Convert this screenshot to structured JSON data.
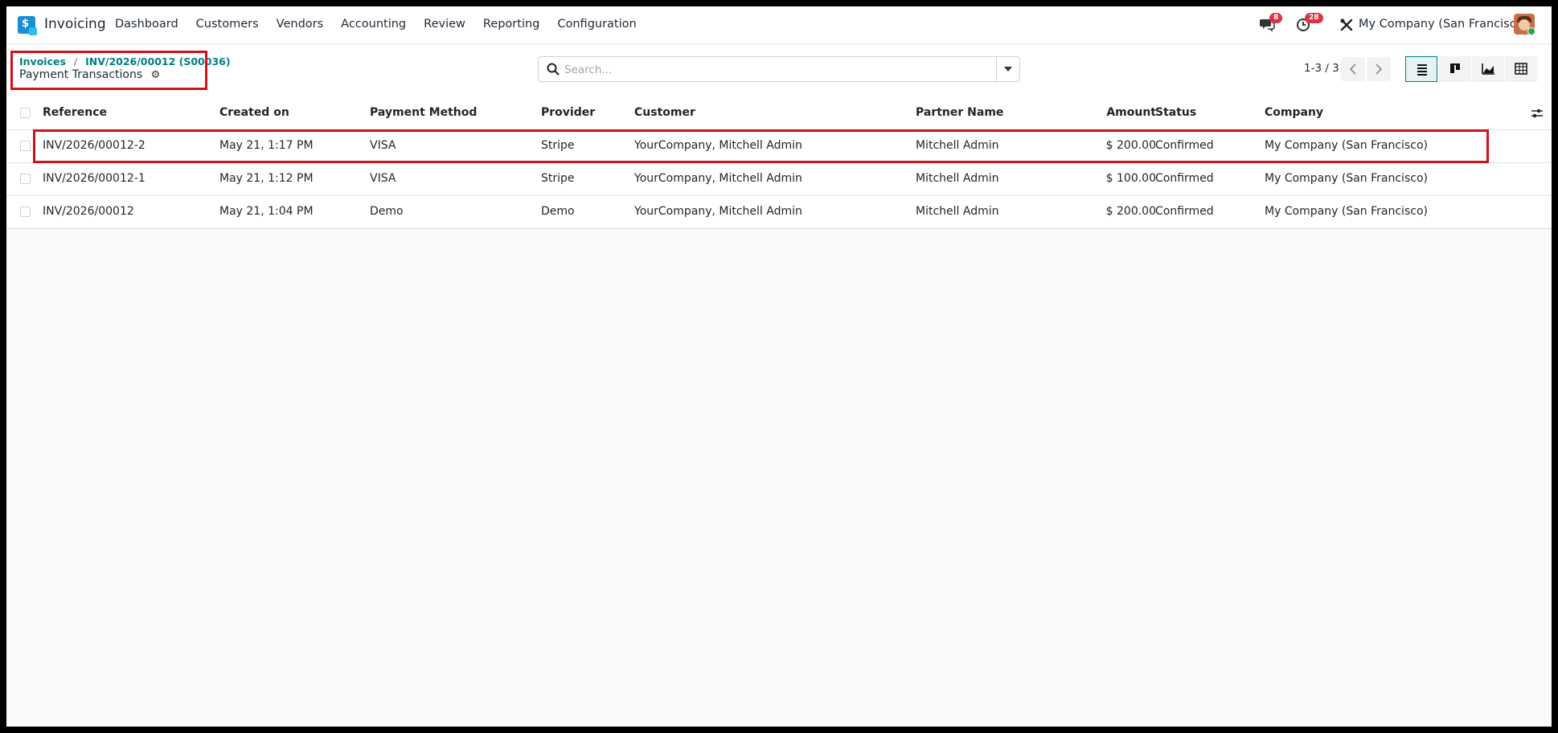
{
  "app": {
    "name": "Invoicing",
    "menu": [
      "Dashboard",
      "Customers",
      "Vendors",
      "Accounting",
      "Review",
      "Reporting",
      "Configuration"
    ]
  },
  "systray": {
    "messages_badge": "8",
    "activities_badge": "28",
    "company": "My Company (San Francisco)"
  },
  "breadcrumb": {
    "items": [
      "Invoices",
      "INV/2026/00012 (S00036)"
    ],
    "current": "Payment Transactions"
  },
  "search": {
    "placeholder": "Search..."
  },
  "pager": {
    "text": "1-3 / 3"
  },
  "table": {
    "columns": [
      "Reference",
      "Created on",
      "Payment Method",
      "Provider",
      "Customer",
      "Partner Name",
      "Amount",
      "Status",
      "Company"
    ],
    "rows": [
      [
        "INV/2026/00012-2",
        "May 21, 1:17 PM",
        "VISA",
        "Stripe",
        "YourCompany, Mitchell Admin",
        "Mitchell Admin",
        "$ 200.00",
        "Confirmed",
        "My Company (San Francisco)"
      ],
      [
        "INV/2026/00012-1",
        "May 21, 1:12 PM",
        "VISA",
        "Stripe",
        "YourCompany, Mitchell Admin",
        "Mitchell Admin",
        "$ 100.00",
        "Confirmed",
        "My Company (San Francisco)"
      ],
      [
        "INV/2026/00012",
        "May 21, 1:04 PM",
        "Demo",
        "Demo",
        "YourCompany, Mitchell Admin",
        "Mitchell Admin",
        "$ 200.00",
        "Confirmed",
        "My Company (San Francisco)"
      ]
    ]
  },
  "colors": {
    "accent": "#017e84",
    "highlight": "#d0121b",
    "badge": "#dc3545"
  }
}
